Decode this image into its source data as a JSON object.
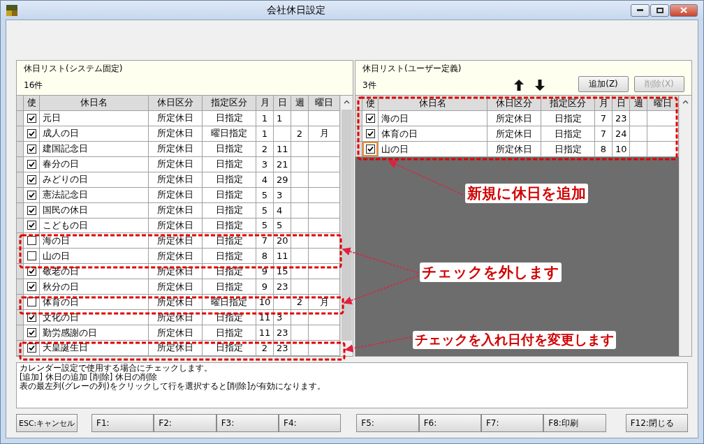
{
  "window": {
    "title": "会社休日設定"
  },
  "left_panel": {
    "title": "休日リスト(システム固定)",
    "count": "16件",
    "columns": [
      "使",
      "休日名",
      "休日区分",
      "指定区分",
      "月",
      "日",
      "週",
      "曜日"
    ],
    "rows": [
      {
        "checked": true,
        "name": "元日",
        "type": "所定休日",
        "rule": "日指定",
        "month": "1",
        "day": "1",
        "week": "",
        "weekday": ""
      },
      {
        "checked": true,
        "name": "成人の日",
        "type": "所定休日",
        "rule": "曜日指定",
        "month": "1",
        "day": "",
        "week": "2",
        "weekday": "月"
      },
      {
        "checked": true,
        "name": "建国記念日",
        "type": "所定休日",
        "rule": "日指定",
        "month": "2",
        "day": "11",
        "week": "",
        "weekday": ""
      },
      {
        "checked": true,
        "name": "春分の日",
        "type": "所定休日",
        "rule": "日指定",
        "month": "3",
        "day": "21",
        "week": "",
        "weekday": ""
      },
      {
        "checked": true,
        "name": "みどりの日",
        "type": "所定休日",
        "rule": "日指定",
        "month": "4",
        "day": "29",
        "week": "",
        "weekday": ""
      },
      {
        "checked": true,
        "name": "憲法記念日",
        "type": "所定休日",
        "rule": "日指定",
        "month": "5",
        "day": "3",
        "week": "",
        "weekday": ""
      },
      {
        "checked": true,
        "name": "国民の休日",
        "type": "所定休日",
        "rule": "日指定",
        "month": "5",
        "day": "4",
        "week": "",
        "weekday": ""
      },
      {
        "checked": true,
        "name": "こどもの日",
        "type": "所定休日",
        "rule": "日指定",
        "month": "5",
        "day": "5",
        "week": "",
        "weekday": ""
      },
      {
        "checked": false,
        "name": "海の日",
        "type": "所定休日",
        "rule": "日指定",
        "month": "7",
        "day": "20",
        "week": "",
        "weekday": ""
      },
      {
        "checked": false,
        "name": "山の日",
        "type": "所定休日",
        "rule": "日指定",
        "month": "8",
        "day": "11",
        "week": "",
        "weekday": ""
      },
      {
        "checked": true,
        "name": "敬老の日",
        "type": "所定休日",
        "rule": "日指定",
        "month": "9",
        "day": "15",
        "week": "",
        "weekday": ""
      },
      {
        "checked": true,
        "name": "秋分の日",
        "type": "所定休日",
        "rule": "日指定",
        "month": "9",
        "day": "23",
        "week": "",
        "weekday": ""
      },
      {
        "checked": false,
        "name": "体育の日",
        "type": "所定休日",
        "rule": "曜日指定",
        "month": "10",
        "day": "",
        "week": "2",
        "weekday": "月"
      },
      {
        "checked": true,
        "name": "文化の日",
        "type": "所定休日",
        "rule": "日指定",
        "month": "11",
        "day": "3",
        "week": "",
        "weekday": ""
      },
      {
        "checked": true,
        "name": "勤労感謝の日",
        "type": "所定休日",
        "rule": "日指定",
        "month": "11",
        "day": "23",
        "week": "",
        "weekday": ""
      },
      {
        "checked": true,
        "name": "天皇誕生日",
        "type": "所定休日",
        "rule": "日指定",
        "month": "2",
        "day": "23",
        "week": "",
        "weekday": ""
      }
    ]
  },
  "right_panel": {
    "title": "休日リスト(ユーザー定義)",
    "count": "3件",
    "buttons": [
      {
        "label": "追加(Z)",
        "disabled": false
      },
      {
        "label": "削除(X)",
        "disabled": true
      }
    ],
    "columns": [
      "使",
      "休日名",
      "休日区分",
      "指定区分",
      "月",
      "日",
      "週",
      "曜日"
    ],
    "rows": [
      {
        "checked": true,
        "selected": false,
        "name": "海の日",
        "type": "所定休日",
        "rule": "日指定",
        "month": "7",
        "day": "23",
        "week": "",
        "weekday": ""
      },
      {
        "checked": true,
        "selected": false,
        "name": "体育の日",
        "type": "所定休日",
        "rule": "日指定",
        "month": "7",
        "day": "24",
        "week": "",
        "weekday": ""
      },
      {
        "checked": true,
        "selected": true,
        "name": "山の日",
        "type": "所定休日",
        "rule": "日指定",
        "month": "8",
        "day": "10",
        "week": "",
        "weekday": ""
      }
    ]
  },
  "message": [
    "カレンダー設定で使用する場合にチェックします。",
    "[追加] 休日の追加 [削除] 休日の削除",
    "表の最左列(グレーの列)をクリックして行を選択すると[削除]が有効になります。"
  ],
  "function_keys": [
    "ESC:キャンセル",
    "F1:",
    "F2:",
    "F3:",
    "F4:",
    "F5:",
    "F6:",
    "F7:",
    "F8:印刷",
    "F12:閉じる"
  ],
  "annotations": [
    "新規に休日を追加",
    "チェックを外します",
    "チェックを入れ日付を変更します"
  ]
}
